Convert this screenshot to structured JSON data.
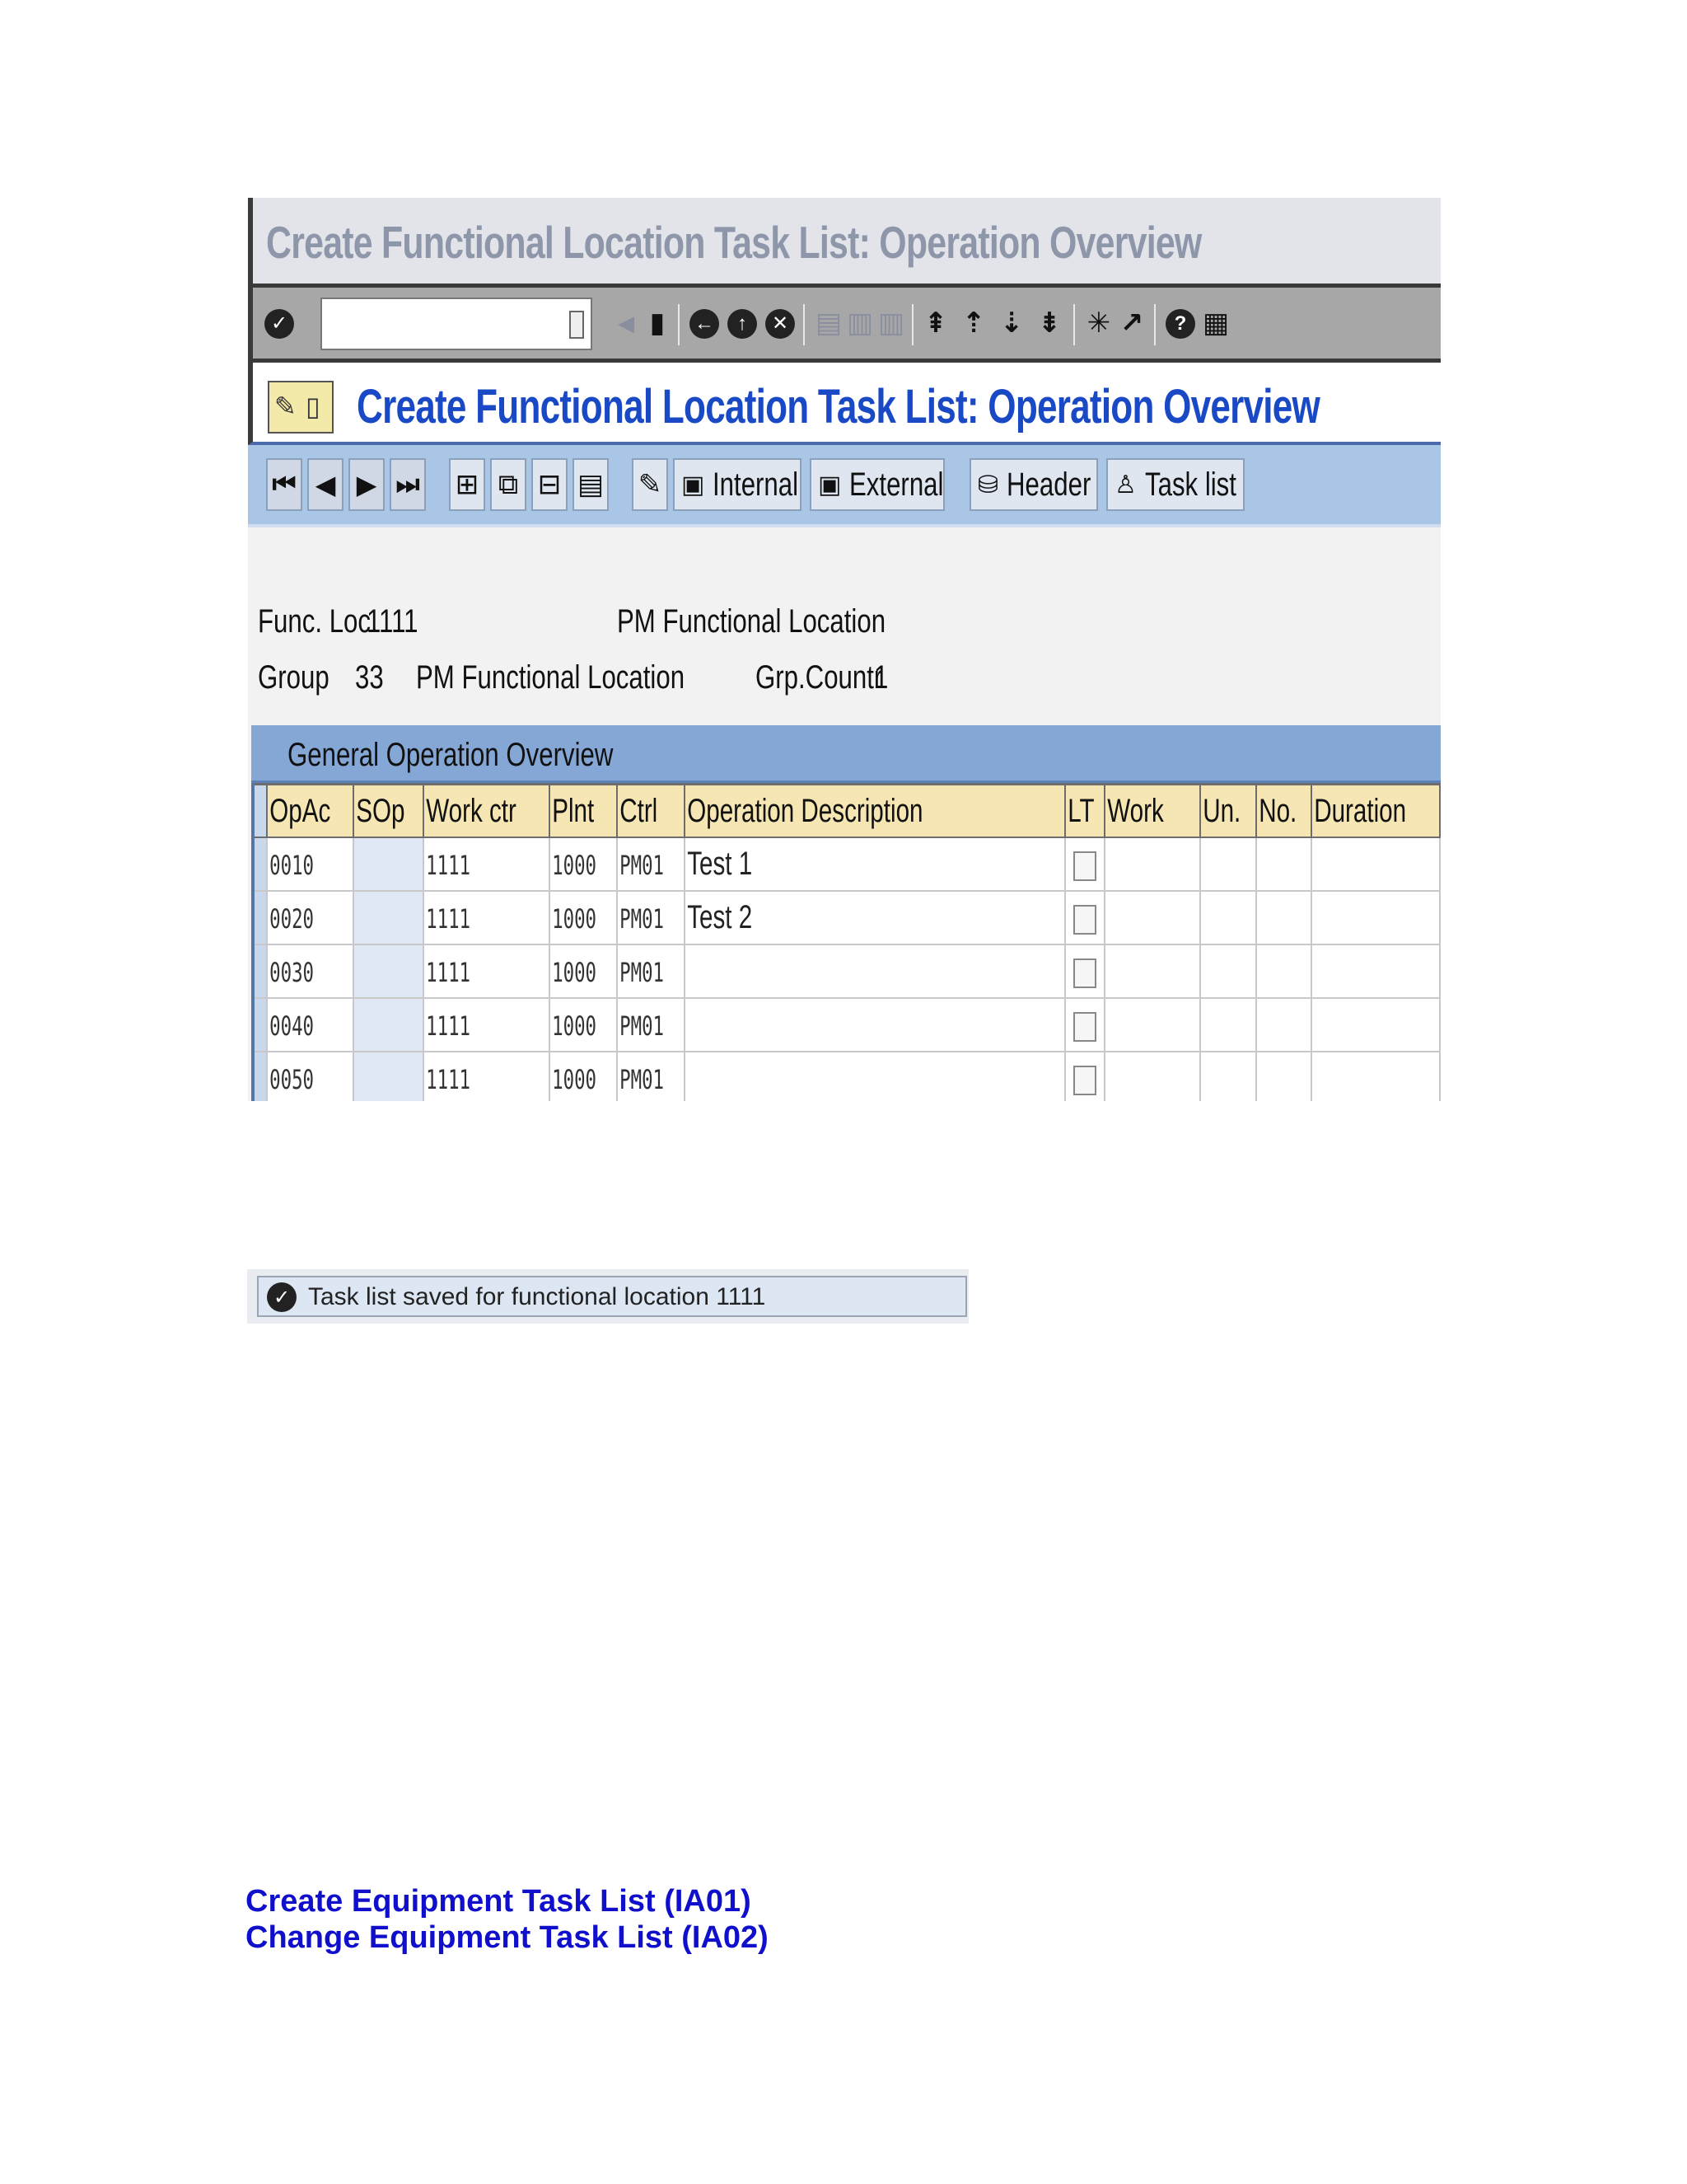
{
  "window_title": "Create Functional Location Task List: Operation Overview",
  "app_title": "Create Functional Location Task List: Operation Overview",
  "command_field": {
    "value": ""
  },
  "toolbar": {
    "internal_label": "Internal",
    "external_label": "External",
    "header_label": "Header",
    "tasklist_label": "Task list"
  },
  "header": {
    "funcloc_label": "Func. Loc.",
    "funcloc_value": "1111",
    "funcloc_desc": "PM Functional Location",
    "group_label": "Group",
    "group_value": "33",
    "group_desc": "PM Functional Location",
    "grpcount_label": "Grp.Countr",
    "grpcount_value": "1"
  },
  "grid": {
    "title": "General Operation Overview",
    "columns": [
      "OpAc",
      "SOp",
      "Work ctr",
      "Plnt",
      "Ctrl",
      "Operation Description",
      "LT",
      "Work",
      "Un.",
      "No.",
      "Duration"
    ],
    "rows": [
      {
        "opac": "0010",
        "sop": "",
        "workctr": "1111",
        "plnt": "1000",
        "ctrl": "PM01",
        "desc": "Test 1",
        "work": "",
        "un": "",
        "no": "",
        "duration": ""
      },
      {
        "opac": "0020",
        "sop": "",
        "workctr": "1111",
        "plnt": "1000",
        "ctrl": "PM01",
        "desc": "Test 2",
        "work": "",
        "un": "",
        "no": "",
        "duration": ""
      },
      {
        "opac": "0030",
        "sop": "",
        "workctr": "1111",
        "plnt": "1000",
        "ctrl": "PM01",
        "desc": "",
        "work": "",
        "un": "",
        "no": "",
        "duration": ""
      },
      {
        "opac": "0040",
        "sop": "",
        "workctr": "1111",
        "plnt": "1000",
        "ctrl": "PM01",
        "desc": "",
        "work": "",
        "un": "",
        "no": "",
        "duration": ""
      },
      {
        "opac": "0050",
        "sop": "",
        "workctr": "1111",
        "plnt": "1000",
        "ctrl": "PM01",
        "desc": "",
        "work": "",
        "un": "",
        "no": "",
        "duration": ""
      }
    ]
  },
  "status": {
    "message": "Task list saved for functional location 1111"
  },
  "document": {
    "heading1": "Create Equipment Task List (IA01)",
    "heading2": "Change Equipment Task List (IA02)"
  }
}
